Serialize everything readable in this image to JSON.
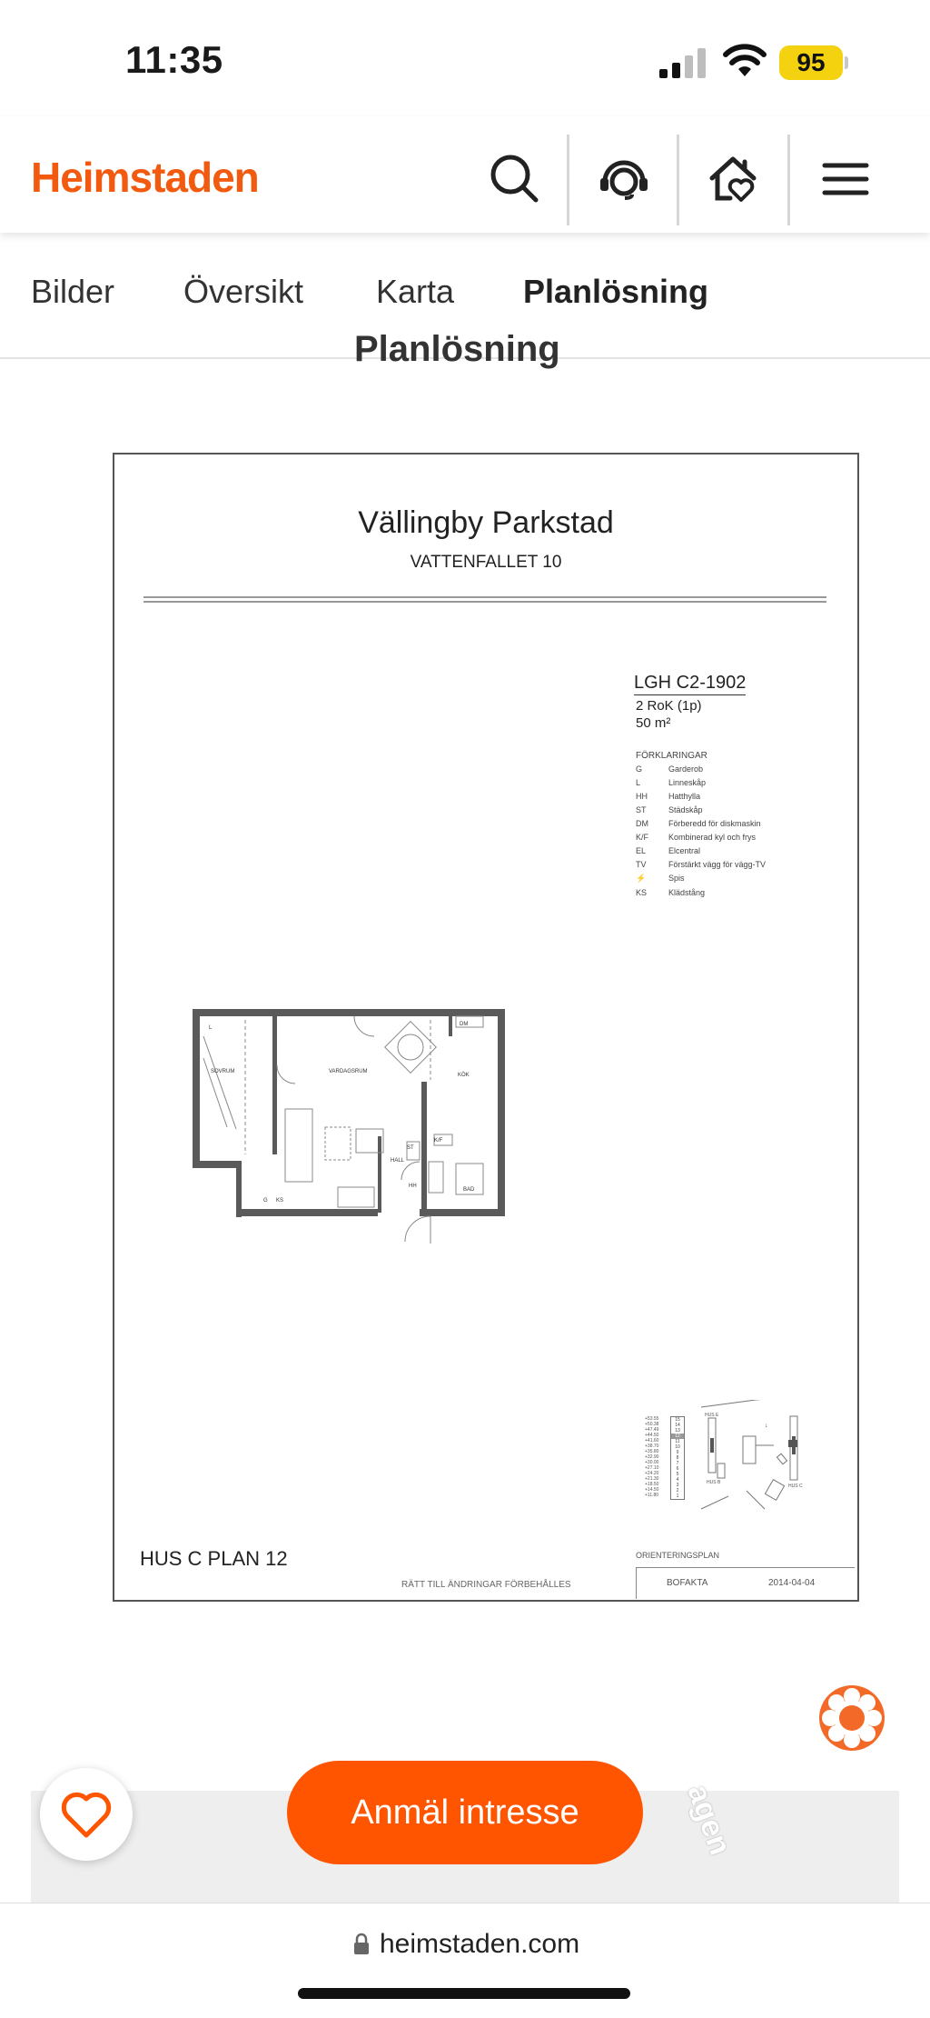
{
  "status_bar": {
    "time": "11:35",
    "battery": "95"
  },
  "header": {
    "brand": "Heimstaden"
  },
  "tabs": [
    {
      "label": "Bilder",
      "active": false
    },
    {
      "label": "Översikt",
      "active": false
    },
    {
      "label": "Karta",
      "active": false
    },
    {
      "label": "Planlösning",
      "active": true
    }
  ],
  "section_heading": "Planlösning",
  "floorplan": {
    "project": "Vällingby Parkstad",
    "address": "VATTENFALLET 10",
    "apartment_id": "LGH C2-1902",
    "rooms": "2 RoK (1p)",
    "area": "50 m²",
    "legend_title": "FÖRKLARINGAR",
    "legend": [
      {
        "code": "G",
        "text": "Garderob"
      },
      {
        "code": "L",
        "text": "Linneskåp"
      },
      {
        "code": "HH",
        "text": "Hatthylla"
      },
      {
        "code": "ST",
        "text": "Städskåp"
      },
      {
        "code": "DM",
        "text": "Förberedd för diskmaskin"
      },
      {
        "code": "K/F",
        "text": "Kombinerad kyl och frys"
      },
      {
        "code": "EL",
        "text": "Elcentral"
      },
      {
        "code": "TV",
        "text": "Förstärkt vägg för vägg-TV"
      },
      {
        "code": "⚡",
        "text": "Spis"
      },
      {
        "code": "KS",
        "text": "Klädstång"
      }
    ],
    "room_labels": {
      "sovrum": "SOVRUM",
      "vardagsrum": "VARDAGSRUM",
      "kok": "KÖK",
      "hall": "HALL",
      "bad": "BAD",
      "kf": "K/F",
      "dm": "DM",
      "st": "ST",
      "hh": "HH",
      "g": "G",
      "ks": "KS",
      "l": "L"
    },
    "floor_levels": [
      "+53.55",
      "+50.38",
      "+47.49",
      "+44.50",
      "+41.60",
      "+38.70",
      "+35.80",
      "+32.90",
      "+30.00",
      "+27.10",
      "+24.20",
      "+21.30",
      "+18.50",
      "+14.50",
      "+11.80"
    ],
    "floor_numbers": [
      "15",
      "14",
      "13",
      "12",
      "11",
      "10",
      "9",
      "8",
      "7",
      "6",
      "5",
      "4",
      "3",
      "2",
      "1"
    ],
    "orientation_label": "ORIENTERINGSPLAN",
    "house_plan": "HUS C PLAN 12",
    "disclaimer": "RÄTT TILL ÄNDRINGAR FÖRBEHÅLLES",
    "company": "BOFAKTA",
    "date": "2014-04-04",
    "site_labels": {
      "hus_e": "HUS E",
      "hus_b": "HUS B",
      "hus_c": "HUS C"
    }
  },
  "cta": {
    "label": "Anmäl intresse"
  },
  "map": {
    "street_fragment": "agen"
  },
  "browser": {
    "url": "heimstaden.com"
  },
  "colors": {
    "brand": "#f25a10",
    "cta": "#ff5500",
    "battery": "#f5d20f"
  }
}
